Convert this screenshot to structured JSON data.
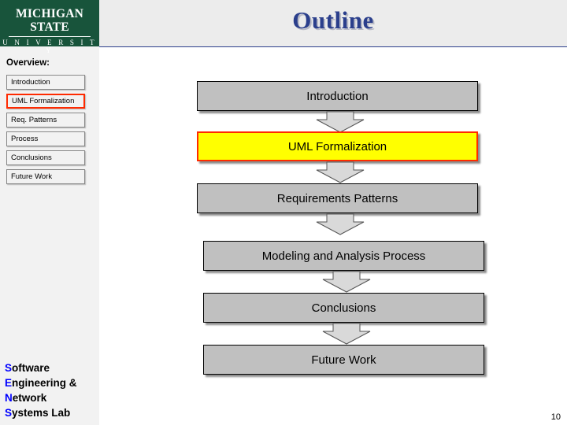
{
  "slide": {
    "title": "Outline",
    "page_number": "10"
  },
  "logo": {
    "university": "MICHIGAN STATE",
    "subtitle": "U N I V E R S I T Y"
  },
  "sidebar": {
    "overview_label": "Overview:",
    "items": [
      {
        "label": "Introduction",
        "current": false
      },
      {
        "label": "UML Formalization",
        "current": true
      },
      {
        "label": "Req. Patterns",
        "current": false
      },
      {
        "label": "Process",
        "current": false
      },
      {
        "label": "Conclusions",
        "current": false
      },
      {
        "label": "Future Work",
        "current": false
      }
    ],
    "lab": [
      {
        "cap": "S",
        "rest": "oftware"
      },
      {
        "cap": "E",
        "rest": "ngineering &"
      },
      {
        "cap": "N",
        "rest": "etwork"
      },
      {
        "cap": "S",
        "rest": "ystems Lab"
      }
    ]
  },
  "flow": {
    "boxes": [
      {
        "label": "Introduction",
        "highlight": false
      },
      {
        "label": "UML Formalization",
        "highlight": true
      },
      {
        "label": "Requirements Patterns",
        "highlight": false
      },
      {
        "label": "Modeling and Analysis Process",
        "highlight": false
      },
      {
        "label": "Conclusions",
        "highlight": false
      },
      {
        "label": "Future Work",
        "highlight": false
      }
    ]
  },
  "colors": {
    "msu_green": "#18543b",
    "title_blue": "#2b3f8c",
    "highlight_yellow": "#ffff00",
    "highlight_border": "#ff2a00",
    "box_gray": "#c0c0c0"
  }
}
